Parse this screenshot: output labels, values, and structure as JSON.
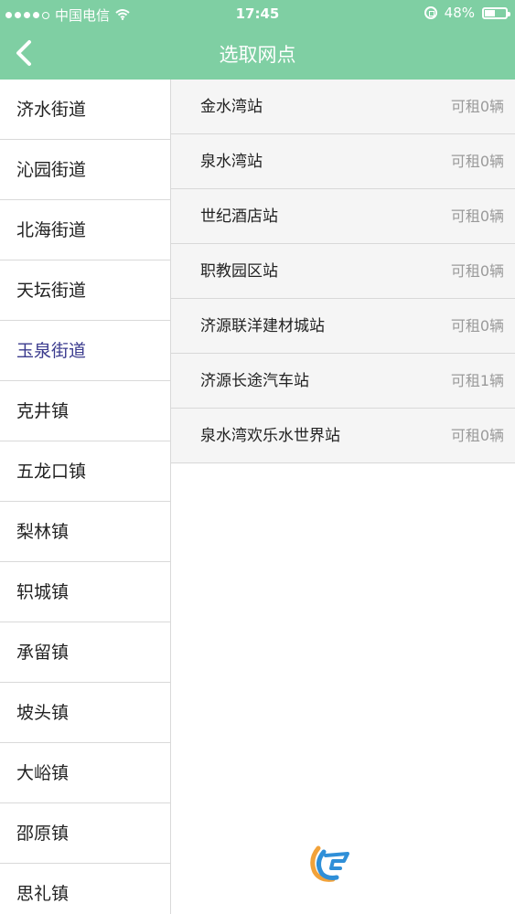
{
  "status_bar": {
    "carrier": "中国电信",
    "time": "17:45",
    "battery": "48%"
  },
  "header": {
    "title": "选取网点"
  },
  "sidebar": {
    "items": [
      {
        "label": "济水街道"
      },
      {
        "label": "沁园街道"
      },
      {
        "label": "北海街道"
      },
      {
        "label": "天坛街道"
      },
      {
        "label": "玉泉街道",
        "selected": true
      },
      {
        "label": "克井镇"
      },
      {
        "label": "五龙口镇"
      },
      {
        "label": "梨林镇"
      },
      {
        "label": "轵城镇"
      },
      {
        "label": "承留镇"
      },
      {
        "label": "坡头镇"
      },
      {
        "label": "大峪镇"
      },
      {
        "label": "邵原镇"
      },
      {
        "label": "思礼镇"
      }
    ]
  },
  "stations": [
    {
      "name": "金水湾站",
      "available": "可租0辆"
    },
    {
      "name": "泉水湾站",
      "available": "可租0辆"
    },
    {
      "name": "世纪酒店站",
      "available": "可租0辆"
    },
    {
      "name": "职教园区站",
      "available": "可租0辆"
    },
    {
      "name": "济源联洋建材城站",
      "available": "可租0辆"
    },
    {
      "name": "济源长途汽车站",
      "available": "可租1辆"
    },
    {
      "name": "泉水湾欢乐水世界站",
      "available": "可租0辆"
    }
  ],
  "colors": {
    "header_green": "#7fcfa3",
    "selected_text": "#3b3b8e",
    "row_bg": "#f5f5f5"
  }
}
